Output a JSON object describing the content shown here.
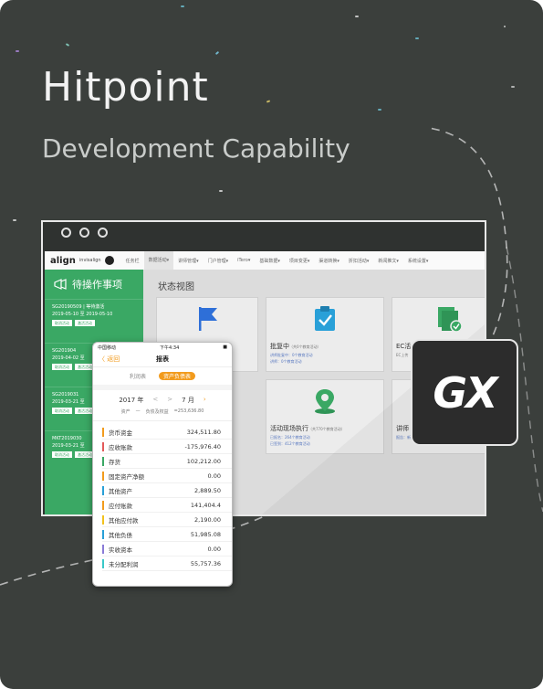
{
  "card": {
    "title": "Hitpoint",
    "subtitle": "Development Capability",
    "background": "#3b3f3c"
  },
  "browser": {
    "topbar": {
      "logo": "align",
      "logo_sub": "invisalign",
      "nav": [
        "任务栏",
        "数据活动▾",
        "讲师管理▾",
        "门户管理▾",
        "iTero▾",
        "基础数据▾",
        "项目变更▾",
        "渠道转换▾",
        "折扣活动▾",
        "新闻推文▾",
        "系统设置▾"
      ]
    },
    "sidebar": {
      "icon": "megaphone-icon",
      "title": "待操作事项",
      "tasks": [
        {
          "id": "SG20190509 | 等待激活",
          "date": "2019-05-10 至 2019-05-10",
          "btn1": "取消活动",
          "btn2": "激活活动"
        },
        {
          "id": "SG201904",
          "date": "2019-04-02 至",
          "btn1": "取消活动",
          "btn2": "激活活动"
        },
        {
          "id": "SG2019031",
          "date": "2019-03-21 至",
          "btn1": "取消活动",
          "btn2": "激活活动"
        },
        {
          "id": "MKT2019030",
          "date": "2019-03-21 至",
          "btn1": "取消活动",
          "btn2": "激活活动"
        }
      ]
    },
    "main": {
      "title": "状态视图",
      "tiles": [
        {
          "label": "",
          "icon": "flag-icon",
          "color": "#2e6fd8"
        },
        {
          "label": "批复中",
          "note": "（共0个教育活动）",
          "sub1": "讲师批复中：0个教育活动",
          "sub2": "讲师：0个教育活动",
          "icon": "clipboard-check-icon",
          "color": "#29a0d8"
        },
        {
          "label": "EC活",
          "sub1": "EC上传",
          "icon": "document-check-icon",
          "color": "#3aa864"
        },
        {
          "label": "活动现场执行",
          "note": "（共770个教育活动）",
          "sub1": "已报名：264个教育活动",
          "sub2": "已签到：412个教育活动",
          "icon": "location-pin-icon",
          "color": "#3aa864"
        },
        {
          "label": "讲师",
          "sub1": "报告：新建讲师表单",
          "icon": "",
          "color": "#888"
        }
      ]
    }
  },
  "phone": {
    "status": {
      "carrier": "中国移动",
      "time": "下午4:34",
      "battery": "■"
    },
    "nav": {
      "back": "〈 返回",
      "title": "报表"
    },
    "tabs": [
      "利润表",
      "资产负债表"
    ],
    "active_tab": 1,
    "month": {
      "year": "2017 年",
      "prev": "<",
      "next": ">",
      "month": "7 月",
      "dropdown": "›"
    },
    "summary": {
      "assets": "资产",
      "minus": "—",
      "liab": "负债及权益",
      "value": "=253,636.80"
    },
    "rows": [
      {
        "name": "货币资金",
        "value": "324,511.80",
        "color": "#f29b1d"
      },
      {
        "name": "应收账款",
        "value": "-175,976.40",
        "color": "#e35a5a"
      },
      {
        "name": "存货",
        "value": "102,212.00",
        "color": "#3aa864"
      },
      {
        "name": "固定资产净额",
        "value": "0.00",
        "color": "#f29b1d"
      },
      {
        "name": "其他资产",
        "value": "2,889.50",
        "color": "#29a0d8"
      },
      {
        "name": "应付账款",
        "value": "141,404.4",
        "color": "#f29b1d"
      },
      {
        "name": "其他应付款",
        "value": "2,190.00",
        "color": "#f2c21d"
      },
      {
        "name": "其他负债",
        "value": "51,985.08",
        "color": "#29a0d8"
      },
      {
        "name": "实收资本",
        "value": "0.00",
        "color": "#8a7bd8"
      },
      {
        "name": "未分配利润",
        "value": "55,757.36",
        "color": "#3ac8c8"
      }
    ]
  },
  "badge": {
    "text": "GX"
  }
}
